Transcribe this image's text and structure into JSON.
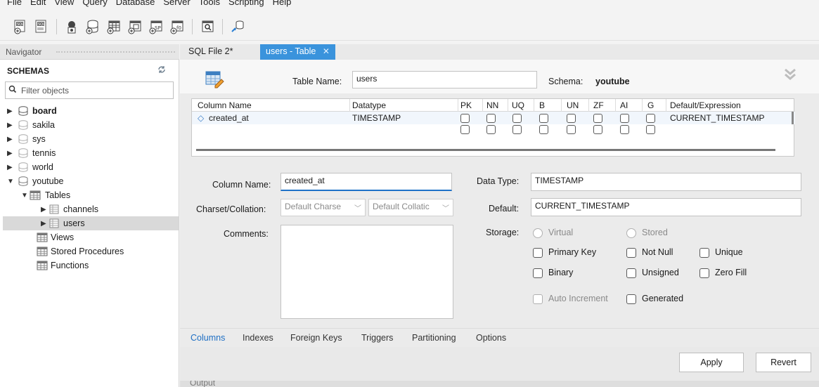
{
  "menu": [
    "File",
    "Edit",
    "View",
    "Query",
    "Database",
    "Server",
    "Tools",
    "Scripting",
    "Help"
  ],
  "toolbar": {
    "icons": [
      "new-sql-tab-icon",
      "open-sql-script-icon",
      "inspector-icon",
      "create-schema-icon",
      "create-table-icon",
      "create-view-icon",
      "create-procedure-icon",
      "create-function-icon",
      "search-table-data-icon",
      "reconnect-icon"
    ]
  },
  "navigator": {
    "header": "Navigator",
    "schemas_title": "SCHEMAS",
    "filter_placeholder": "Filter objects",
    "schemas": [
      {
        "name": "board",
        "bold": true
      },
      {
        "name": "sakila"
      },
      {
        "name": "sys"
      },
      {
        "name": "tennis"
      },
      {
        "name": "world"
      },
      {
        "name": "youtube"
      }
    ],
    "youtube_children": {
      "tables_label": "Tables",
      "tables": [
        "channels",
        "users"
      ],
      "views_label": "Views",
      "procedures_label": "Stored Procedures",
      "functions_label": "Functions"
    }
  },
  "tabs": [
    {
      "label": "SQL File 2*",
      "active": false
    },
    {
      "label": "users - Table",
      "active": true
    }
  ],
  "editor": {
    "table_name_label": "Table Name:",
    "table_name": "users",
    "schema_label": "Schema:",
    "schema": "youtube",
    "grid": {
      "headers": [
        "Column Name",
        "Datatype",
        "PK",
        "NN",
        "UQ",
        "B",
        "UN",
        "ZF",
        "AI",
        "G",
        "Default/Expression"
      ],
      "rows": [
        {
          "name": "created_at",
          "datatype": "TIMESTAMP",
          "default": "CURRENT_TIMESTAMP"
        }
      ]
    },
    "column_name_label": "Column Name:",
    "column_name": "created_at",
    "charset_label": "Charset/Collation:",
    "charset": "Default Charse",
    "collation": "Default Collatic",
    "comments_label": "Comments:",
    "data_type_label": "Data Type:",
    "data_type": "TIMESTAMP",
    "default_label": "Default:",
    "default": "CURRENT_TIMESTAMP",
    "storage_label": "Storage:",
    "virtual": "Virtual",
    "stored": "Stored",
    "primary_key": "Primary Key",
    "not_null": "Not Null",
    "unique": "Unique",
    "binary": "Binary",
    "unsigned": "Unsigned",
    "zero_fill": "Zero Fill",
    "auto_increment": "Auto Increment",
    "generated": "Generated"
  },
  "subtabs": [
    "Columns",
    "Indexes",
    "Foreign Keys",
    "Triggers",
    "Partitioning",
    "Options"
  ],
  "buttons": {
    "apply": "Apply",
    "revert": "Revert"
  },
  "output_label": "Output"
}
